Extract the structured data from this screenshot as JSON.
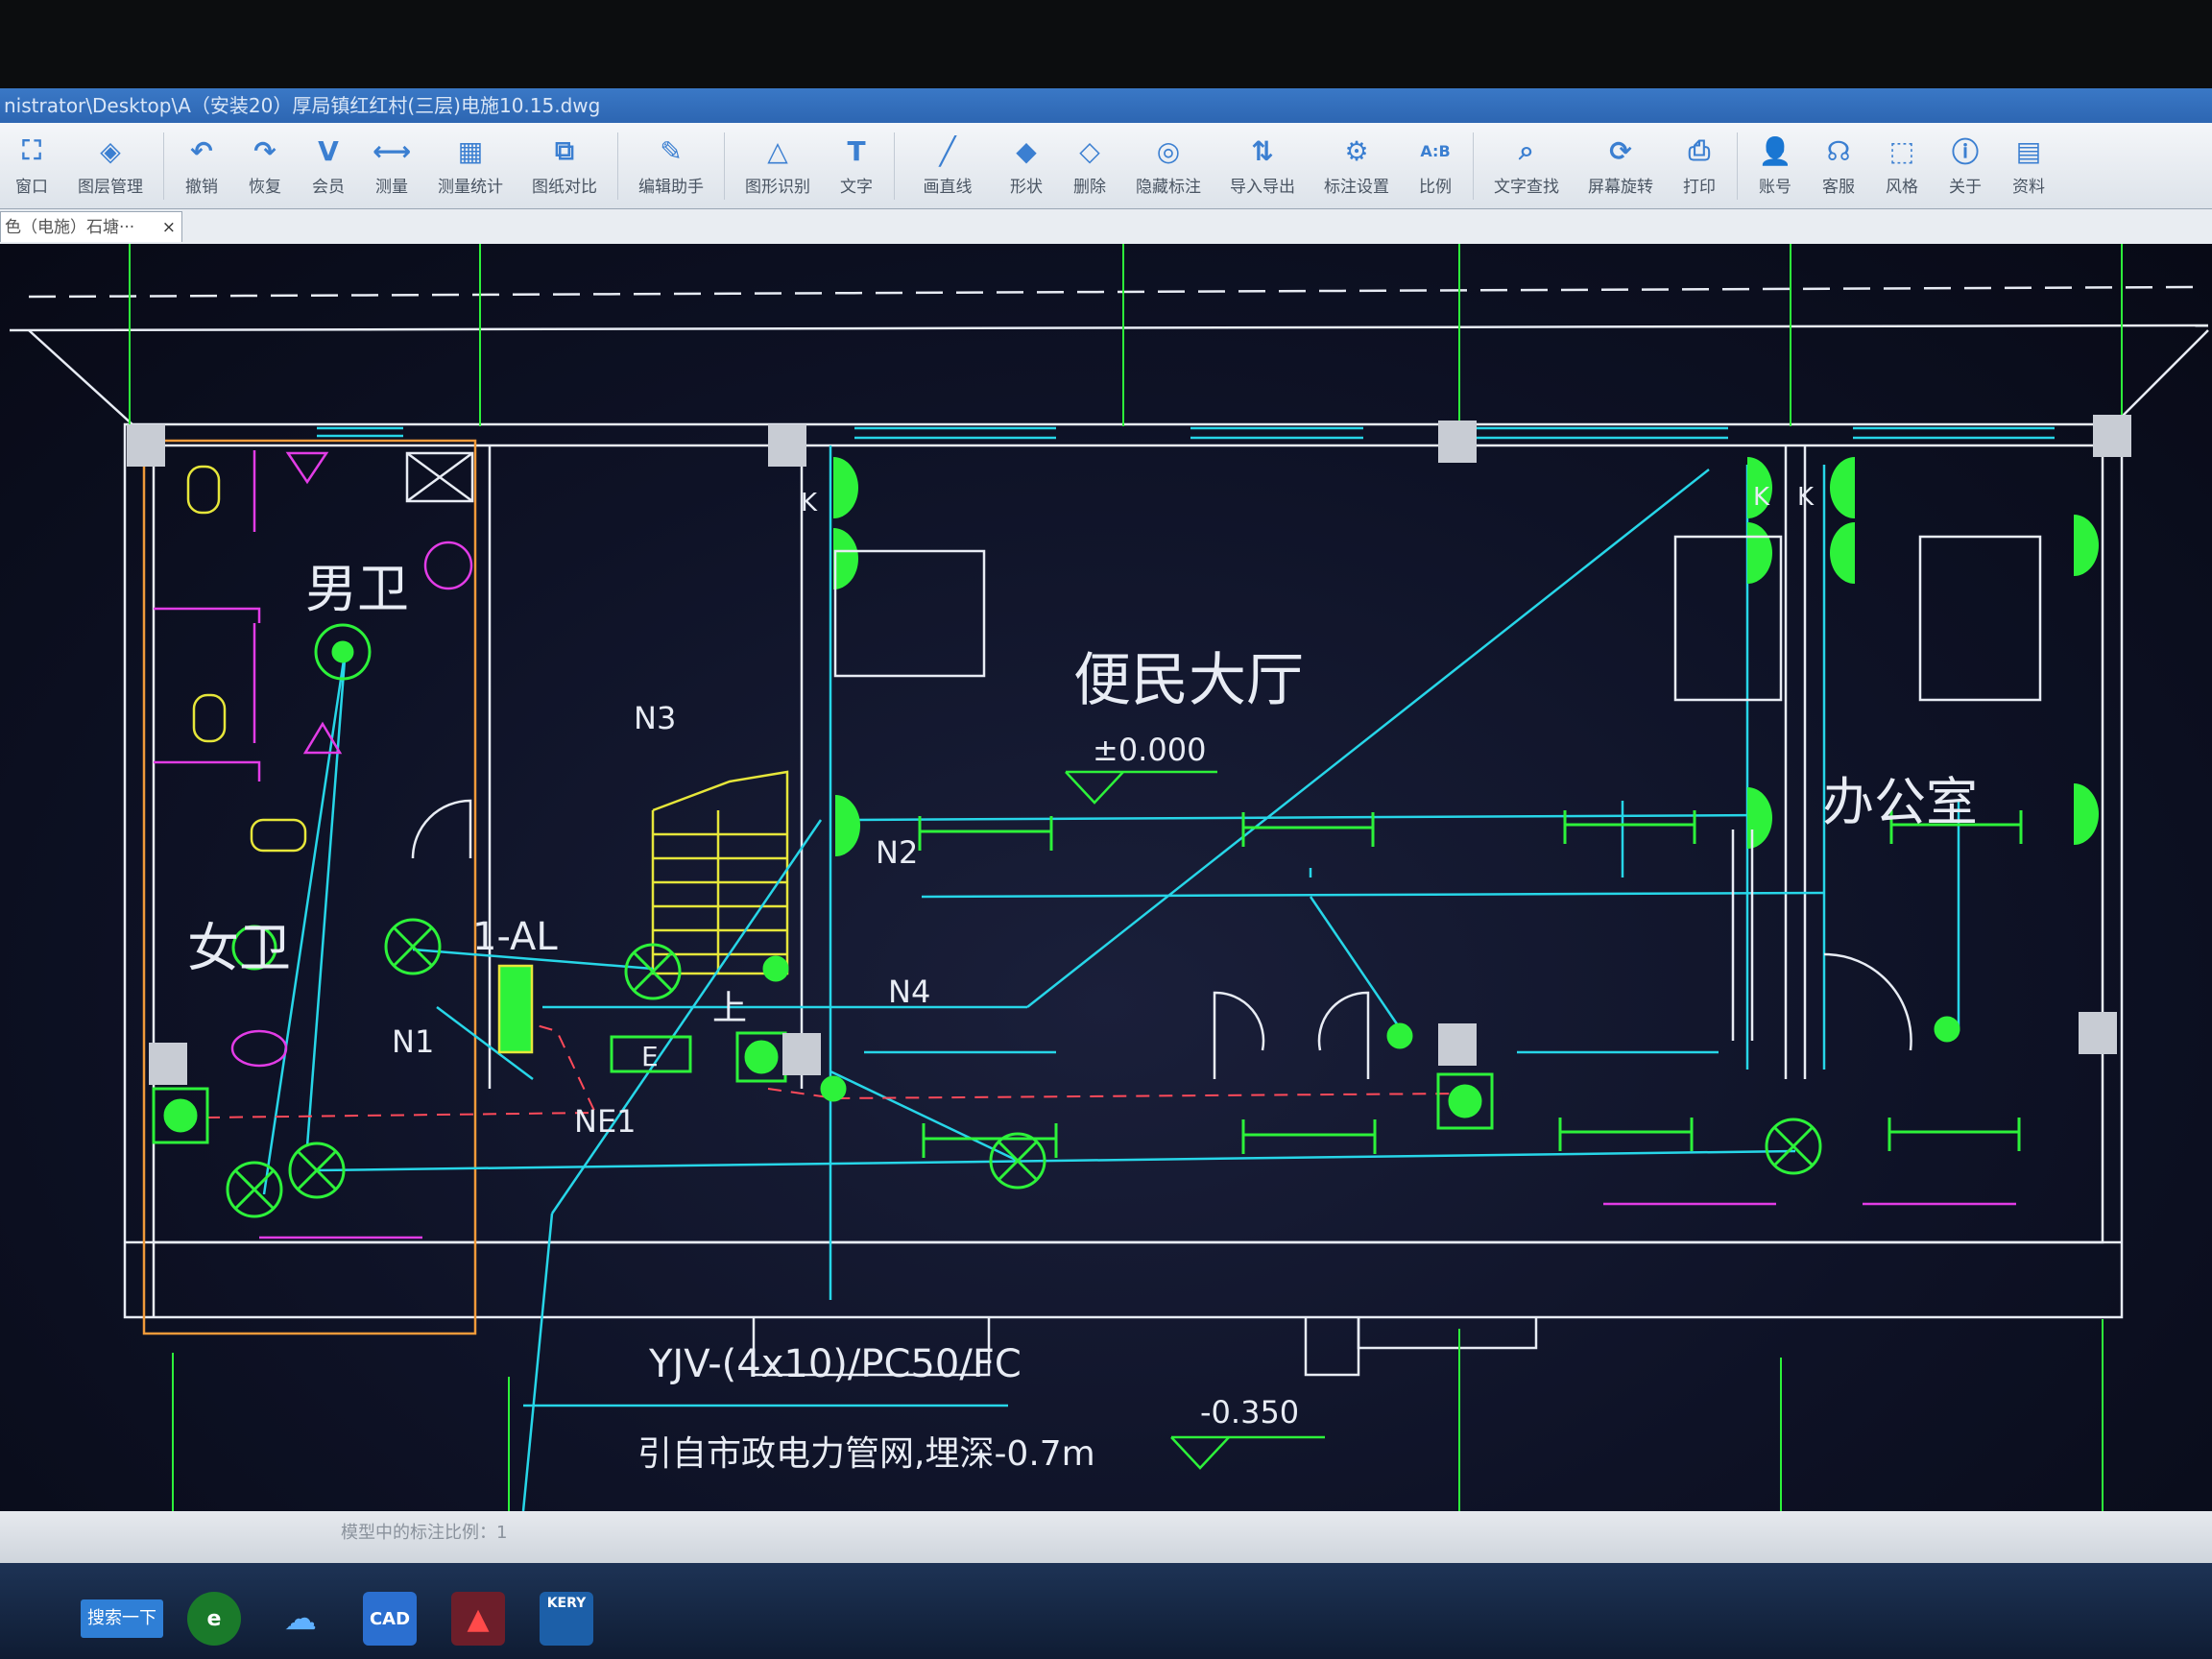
{
  "window": {
    "title": "nistrator\\Desktop\\A（安装20）厚局镇红红村(三层)电施10.15.dwg"
  },
  "toolbar": {
    "items": [
      {
        "label": "窗口",
        "icon": "window-icon"
      },
      {
        "label": "图层管理",
        "icon": "layers-icon"
      },
      {
        "label": "撤销",
        "icon": "undo-icon"
      },
      {
        "label": "恢复",
        "icon": "redo-icon"
      },
      {
        "label": "会员",
        "icon": "vip-icon"
      },
      {
        "label": "测量",
        "icon": "measure-icon"
      },
      {
        "label": "测量统计",
        "icon": "measure-stats-icon"
      },
      {
        "label": "图纸对比",
        "icon": "compare-icon"
      },
      {
        "label": "编辑助手",
        "icon": "edit-assistant-icon"
      },
      {
        "label": "图形识别",
        "icon": "shape-recognize-icon"
      },
      {
        "label": "文字",
        "icon": "text-icon"
      },
      {
        "label": "画直线",
        "icon": "line-icon"
      },
      {
        "label": "形状",
        "icon": "shape-icon"
      },
      {
        "label": "删除",
        "icon": "eraser-icon"
      },
      {
        "label": "隐藏标注",
        "icon": "hide-annotation-icon"
      },
      {
        "label": "导入导出",
        "icon": "import-export-icon"
      },
      {
        "label": "标注设置",
        "icon": "annotation-settings-icon"
      },
      {
        "label": "比例",
        "icon": "scale-icon"
      },
      {
        "label": "文字查找",
        "icon": "text-search-icon"
      },
      {
        "label": "屏幕旋转",
        "icon": "rotate-screen-icon"
      },
      {
        "label": "打印",
        "icon": "print-icon"
      },
      {
        "label": "账号",
        "icon": "account-icon"
      },
      {
        "label": "客服",
        "icon": "headset-icon"
      },
      {
        "label": "风格",
        "icon": "style-icon"
      },
      {
        "label": "关于",
        "icon": "info-icon"
      },
      {
        "label": "资料",
        "icon": "materials-icon"
      }
    ]
  },
  "doc_tab": {
    "label": "色（电施）石塘···",
    "close": "×"
  },
  "drawing": {
    "room_labels": {
      "mens_toilet": "男卫",
      "womens_toilet": "女卫",
      "hall": "便民大厅",
      "office": "办公室"
    },
    "elevation_main": "±0.000",
    "elevation_outside": "-0.350",
    "circuits": {
      "n1": "N1",
      "n2": "N2",
      "n3": "N3",
      "n4": "N4",
      "ne1": "NE1"
    },
    "panel_label": "1-AL",
    "stair_up": "上",
    "exit_sign": "E",
    "switch_k": "K",
    "cable_spec": "YJV-(4x10)/PC50/FC",
    "cable_source": "引自市政电力管网,埋深-0.7m",
    "colors": {
      "cyan": "#27d6e8",
      "green": "#2df23a",
      "white": "#e8ecf4",
      "magenta": "#e23ce6",
      "yellow": "#e6e63a",
      "orange": "#f09a3a",
      "red": "#ff4a5a"
    }
  },
  "status": {
    "text": "模型中的标注比例：1"
  },
  "taskbar": {
    "start_label": "搜索一下",
    "cad_label": "CAD",
    "kery_label": "KERY"
  }
}
